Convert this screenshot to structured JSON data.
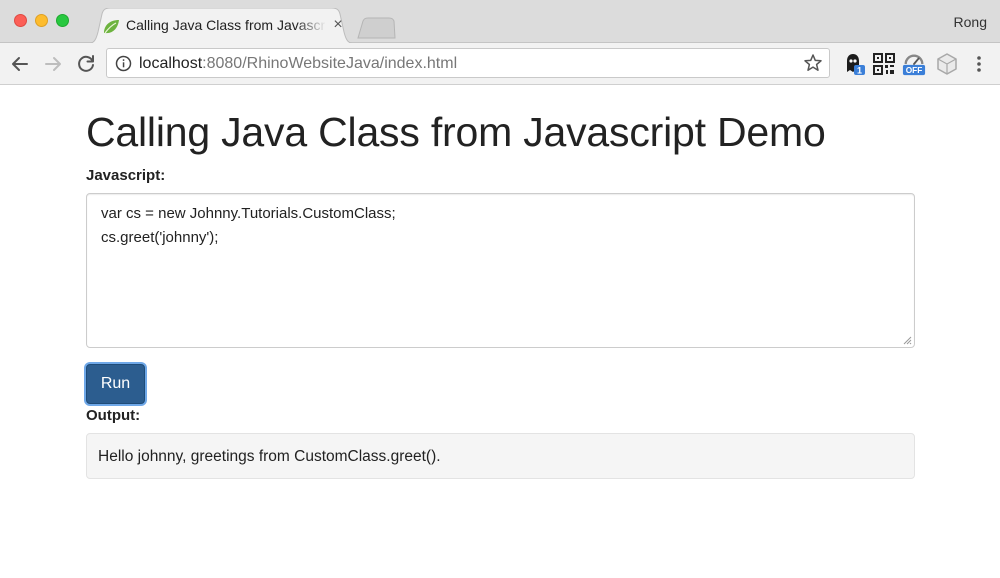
{
  "browser": {
    "tab_title": "Calling Java Class from Javascript Demo",
    "tab_close": "×",
    "profile_name": "Rong",
    "url_host": "localhost",
    "url_rest": ":8080/RhinoWebsiteJava/index.html",
    "extensions": [
      {
        "name": "ghostery-icon",
        "badge": "1"
      },
      {
        "name": "qr-code-icon"
      },
      {
        "name": "speed-off-icon",
        "badge": "OFF"
      },
      {
        "name": "cube-icon"
      }
    ],
    "colors": {
      "tab_favicon": "#6db33f",
      "badge_blue": "#3b7fd8"
    }
  },
  "page": {
    "title": "Calling Java Class from Javascript Demo",
    "javascript_label": "Javascript:",
    "code_lines": [
      "var cs = new Johnny.Tutorials.CustomClass;",
      "cs.greet('johnny');"
    ],
    "run_label": "Run",
    "output_label": "Output:",
    "output_text": "Hello johnny, greetings from CustomClass.greet().",
    "colors": {
      "run_button": "#2c5d8f",
      "output_bg": "#f5f5f5"
    }
  }
}
